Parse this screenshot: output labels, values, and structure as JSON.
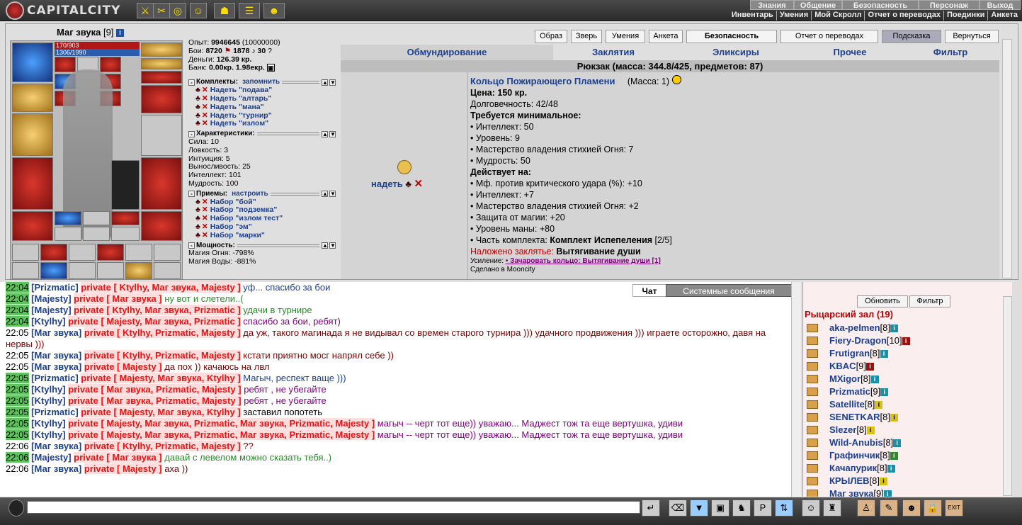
{
  "topbar": {
    "logo": "CAPITALCITY",
    "menu_row1": [
      "Знания",
      "Общение",
      "Безопасность",
      "Персонаж",
      "Выход"
    ],
    "menu_row2": [
      "Инвентарь",
      "Умения",
      "Мой Скролл",
      "Отчет о переводах",
      "Поединки",
      "Анкета"
    ]
  },
  "character": {
    "name": "Маг звука",
    "level": "[9]",
    "hp": "170/903",
    "mana": "1306/1990",
    "exp_label": "Опыт:",
    "exp": "9946645",
    "exp_next": "(10000000)",
    "fights_label": "Бои:",
    "fights_w": "8720",
    "fights_l": "1878",
    "fights_d": "30",
    "money_label": "Деньги:",
    "money": "126.39 кр.",
    "bank_label": "Банк:",
    "bank": "0.00кр. 1.98екр."
  },
  "sets": {
    "title": "Комплекты:",
    "remember": "запомнить",
    "items": [
      "Надеть \"подава\"",
      "Надеть \"алтарь\"",
      "Надеть \"мана\"",
      "Надеть \"турнир\"",
      "Надеть \"излом\""
    ]
  },
  "stats": {
    "title": "Характеристики:",
    "items": [
      "Сила: 10",
      "Ловкость: 3",
      "Интуиция: 5",
      "Выносливость: 25",
      "Интеллект: 101",
      "Мудрость: 100"
    ]
  },
  "tricks": {
    "title": "Приемы:",
    "configure": "настроить",
    "items": [
      "Набор \"бой\"",
      "Набор \"подземка\"",
      "Набор \"излом тест\"",
      "Набор \"эм\"",
      "Набор \"марки\""
    ]
  },
  "power": {
    "title": "Мощность:",
    "items": [
      "Магия Огня: -798%",
      "Магия Воды: -881%"
    ]
  },
  "buttons": [
    "Образ",
    "Зверь",
    "Умения",
    "Анкета",
    "Безопасность",
    "Отчет о переводах",
    "Подсказка",
    "Вернуться"
  ],
  "tabs": [
    "Обмундирование",
    "Заклятия",
    "Эликсиры",
    "Прочее",
    "Фильтр"
  ],
  "bag_title": "Рюкзак (масса: 344.8/425, предметов: 87)",
  "item": {
    "wear": "надеть",
    "name": "Кольцо Пожирающего Пламени",
    "mass": "(Масса: 1)",
    "price": "Цена: 150 кр.",
    "durability": "Долговечность: 42/48",
    "req_title": "Требуется минимальное:",
    "reqs": [
      "• Интеллект: 50",
      "• Уровень: 9",
      "• Мастерство владения стихией Огня: 7",
      "• Мудрость: 50"
    ],
    "acts_title": "Действует на:",
    "acts": [
      "• Мф. против критического удара (%): +10",
      "• Интеллект: +7",
      "• Мастерство владения стихией Огня: +2",
      "• Защита от магии: +20",
      "• Уровень маны: +80"
    ],
    "set_part_prefix": "• Часть комплекта:",
    "set_part_name": "Комплект Испепеления",
    "set_part_count": "[2/5]",
    "spell_label": "Наложено заклятье:",
    "spell_name": "Вытягивание души",
    "boost_label": "Усиление:",
    "boost_link": "• Зачаровать кольцо: Вытягивание души [1]",
    "made_in": "Сделано в Mooncity"
  },
  "chat_tabs": [
    "Чат",
    "Системные сообщения"
  ],
  "chat": [
    {
      "t": "22:04",
      "hl": true,
      "n": "Prizmatic",
      "p": "private [ Ktylhy, Маг звука, Majesty ]",
      "m": "уф... спасибо за бои",
      "c": "#1c3f90"
    },
    {
      "t": "22:04",
      "hl": true,
      "n": "Majesty",
      "p": "private [ Маг звука ]",
      "m": "ну вот и слетели..(",
      "c": "#2a8a2a"
    },
    {
      "t": "22:04",
      "hl": true,
      "n": "Majesty",
      "p": "private [ Ktylhy, Маг звука, Prizmatic ]",
      "m": "удачи в турнире",
      "c": "#2a8a2a"
    },
    {
      "t": "22:04",
      "hl": true,
      "n": "Ktylhy",
      "p": "private [ Majesty, Маг звука, Prizmatic ]",
      "m": "спасибо за бои, ребят)",
      "c": "#800080"
    },
    {
      "t": "22:05",
      "hl": false,
      "n": "Маг звука",
      "p": "private [ Ktylhy, Prizmatic, Majesty ]",
      "m": "да уж, такого магинада я не видывал со времен старого турнира ))) удачного продвижения ))) играете осторожно, давя на нервы )))",
      "c": "#800000",
      "wrap": true
    },
    {
      "t": "22:05",
      "hl": false,
      "n": "Маг звука",
      "p": "private [ Ktylhy, Prizmatic, Majesty ]",
      "m": "кстати приятно мосг напрял себе ))",
      "c": "#800000"
    },
    {
      "t": "22:05",
      "hl": false,
      "n": "Маг звука",
      "p": "private [ Majesty ]",
      "m": "да пох )) качаюсь на лвл",
      "c": "#800000"
    },
    {
      "t": "22:05",
      "hl": true,
      "n": "Prizmatic",
      "p": "private [ Majesty, Маг звука, Ktylhy ]",
      "m": "Магыч, респект ваще )))",
      "c": "#1c3f90"
    },
    {
      "t": "22:05",
      "hl": true,
      "n": "Ktylhy",
      "p": "private [ Маг звука, Prizmatic, Majesty ]",
      "m": "ребят , не убегайте",
      "c": "#800080"
    },
    {
      "t": "22:05",
      "hl": true,
      "n": "Ktylhy",
      "p": "private [ Маг звука, Prizmatic, Majesty ]",
      "m": "ребят , не убегайте",
      "c": "#800080"
    },
    {
      "t": "22:05",
      "hl": true,
      "n": "Prizmatic",
      "p": "private [ Majesty, Маг звука, Ktylhy ]",
      "m": "заставил попотеть",
      "c": "#000000"
    },
    {
      "t": "22:05",
      "hl": true,
      "n": "Ktylhy",
      "p": "private [ Majesty, Маг звука, Prizmatic, Маг звука, Prizmatic, Majesty ]",
      "m": "магыч -- черт тот еще)) уважаю... Маджест тож та еще вертушка, удиви",
      "c": "#800080",
      "wrap": true
    },
    {
      "t": "22:05",
      "hl": true,
      "n": "Ktylhy",
      "p": "private [ Majesty, Маг звука, Prizmatic, Маг звука, Prizmatic, Majesty ]",
      "m": "магыч -- черт тот еще)) уважаю... Маджест тож та еще вертушка, удиви",
      "c": "#800080",
      "wrap": true
    },
    {
      "t": "22:06",
      "hl": false,
      "n": "Маг звука",
      "p": "private [ Ktylhy, Prizmatic, Majesty ]",
      "m": "??",
      "c": "#800000"
    },
    {
      "t": "22:06",
      "hl": true,
      "n": "Majesty",
      "p": "private [ Маг звука ]",
      "m": "давай с левелом можно сказать тебя..)",
      "c": "#2a8a2a"
    },
    {
      "t": "22:06",
      "hl": false,
      "n": "Маг звука",
      "p": "private [ Majesty ]",
      "m": "аха ))",
      "c": "#800000"
    }
  ],
  "userlist": {
    "refresh": "Обновить",
    "filter": "Фильтр",
    "room": "Рыцарский зал (19)",
    "users": [
      {
        "n": "aka-pelmen",
        "l": "[8]",
        "b": "i",
        "bc": "b-blue"
      },
      {
        "n": "Fiery-Dragon",
        "l": "[10]",
        "b": "i",
        "bc": "b-red"
      },
      {
        "n": "Frutigran",
        "l": "[8]",
        "b": "i",
        "bc": "b-blue"
      },
      {
        "n": "KBAC",
        "l": "[9]",
        "b": "i",
        "bc": "b-red"
      },
      {
        "n": "MXigor",
        "l": "[8]",
        "b": "i",
        "bc": "b-blue"
      },
      {
        "n": "Prizmatic",
        "l": "[9]",
        "b": "i",
        "bc": "b-blue"
      },
      {
        "n": "Satellite",
        "l": "[8]",
        "b": "i",
        "bc": "b-yel"
      },
      {
        "n": "SENETKAR",
        "l": "[8]",
        "b": "i",
        "bc": "b-yel"
      },
      {
        "n": "Slezer",
        "l": "[8]",
        "b": "i",
        "bc": "b-yel"
      },
      {
        "n": "Wild-Anubis",
        "l": "[8]",
        "b": "i",
        "bc": "b-blue"
      },
      {
        "n": "Графинчик",
        "l": "[8]",
        "b": "i",
        "bc": "b-grn"
      },
      {
        "n": "Качапурик",
        "l": "[8]",
        "b": "i",
        "bc": "b-blue"
      },
      {
        "n": "КРЫЛЕВ",
        "l": "[8]",
        "b": "i",
        "bc": "b-yel"
      },
      {
        "n": "Маг звука",
        "l": "[9]",
        "b": "i",
        "bc": "b-blue"
      }
    ]
  },
  "input": {
    "placeholder": ""
  }
}
